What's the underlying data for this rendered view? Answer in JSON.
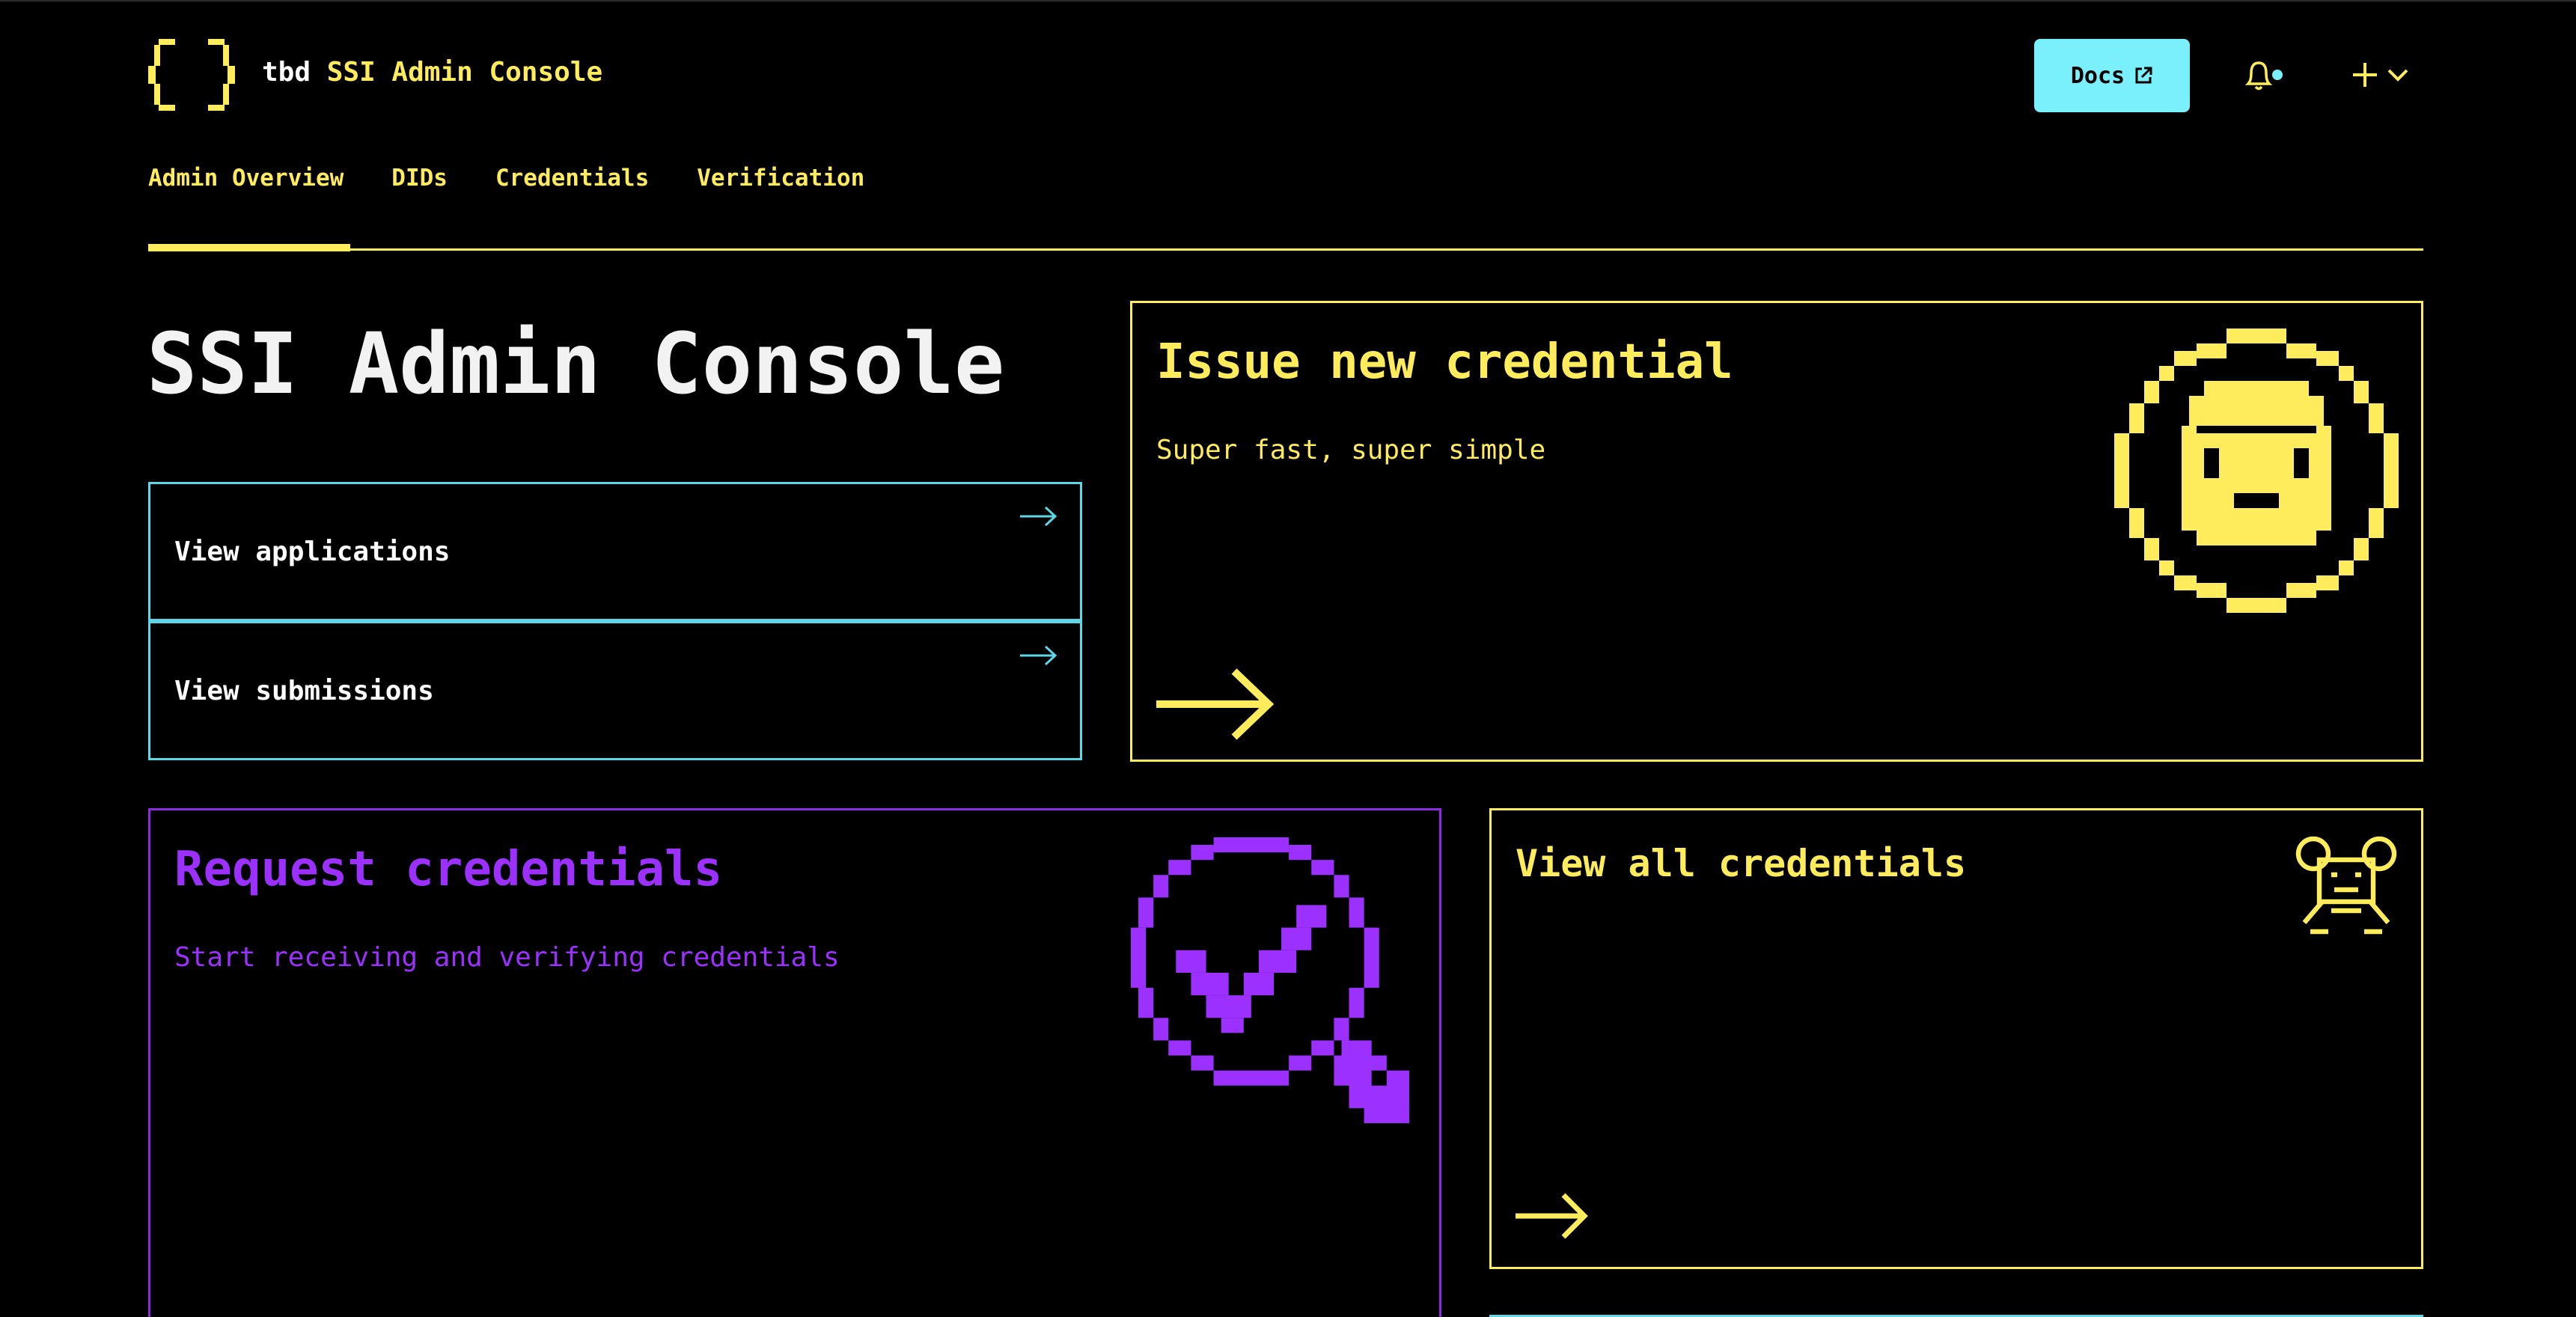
{
  "header": {
    "brand_prefix": "tbd",
    "brand_name": "SSI Admin Console",
    "docs_label": "Docs"
  },
  "nav": {
    "tabs": [
      {
        "label": "Admin Overview",
        "active": true
      },
      {
        "label": "DIDs"
      },
      {
        "label": "Credentials"
      },
      {
        "label": "Verification"
      }
    ]
  },
  "main": {
    "title": "SSI Admin Console",
    "links": [
      {
        "label": "View applications"
      },
      {
        "label": "View submissions"
      }
    ],
    "cards": {
      "issue": {
        "title": "Issue new credential",
        "subtitle": "Super fast, super simple"
      },
      "request": {
        "title": "Request credentials",
        "subtitle": "Start receiving and verifying credentials"
      },
      "view_all": {
        "title": "View all credentials"
      }
    }
  },
  "colors": {
    "background": "#000000",
    "yellow": "#ffec5c",
    "cyan": "#79f0fb",
    "purple": "#9b30ff"
  },
  "icons": [
    "braces-logo-icon",
    "external-link-icon",
    "bell-icon",
    "notification-dot-icon",
    "plus-icon",
    "chevron-down-icon",
    "arrow-right-icon",
    "pixel-face-badge-icon",
    "pixel-check-magnifier-icon",
    "pixel-characters-icon"
  ]
}
